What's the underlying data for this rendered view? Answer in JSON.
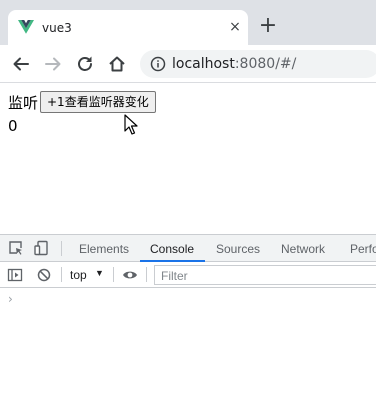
{
  "browser": {
    "tab": {
      "title": "vue3",
      "favicon": "vue-logo-icon",
      "close_glyph": "×"
    },
    "new_tab_glyph": "+",
    "toolbar": {
      "back": "back-arrow-icon",
      "forward": "forward-arrow-icon",
      "reload": "reload-icon",
      "home": "home-icon"
    },
    "address": {
      "host": "localhost",
      "rest": ":8080/#/"
    }
  },
  "page": {
    "watch_label": "监听",
    "button_label": "+1查看监听器变化",
    "count": "0"
  },
  "devtools": {
    "tabs": [
      "Elements",
      "Console",
      "Sources",
      "Network",
      "Perfo"
    ],
    "active_tab": "Console",
    "context": "top",
    "filter_placeholder": "Filter",
    "prompt_glyph": "›"
  },
  "colors": {
    "active_tab_underline": "#1a73e8",
    "vue_green": "#41b883",
    "vue_dark": "#35495e"
  }
}
